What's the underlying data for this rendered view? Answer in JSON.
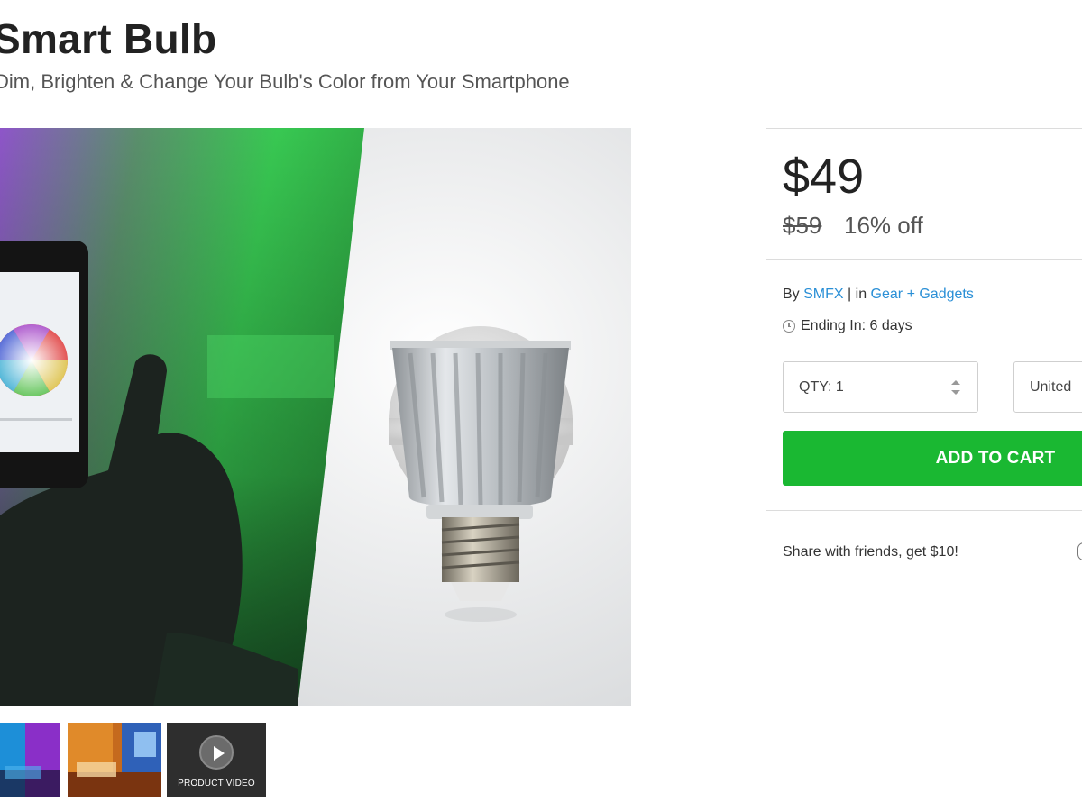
{
  "product": {
    "title": "Smart Bulb",
    "subtitle": "Dim, Brighten & Change Your Bulb's Color from Your Smartphone"
  },
  "gallery": {
    "main_image_icon": "product-photo",
    "thumbnails": [
      {
        "icon": "bedroom-purple-light-photo"
      },
      {
        "icon": "bedroom-orange-light-photo"
      },
      {
        "icon": "play-icon",
        "label": "PRODUCT VIDEO"
      }
    ]
  },
  "pricing": {
    "price": "$49",
    "original_price": "$59",
    "discount": "16% off"
  },
  "meta": {
    "by_prefix": "By",
    "vendor": "SMFX",
    "separator": "|",
    "in_prefix": "in",
    "category": "Gear + Gadgets",
    "ending": "Ending In: 6 days"
  },
  "purchase": {
    "quantity_label": "QTY: 1",
    "country": "United",
    "add_to_cart": "ADD TO CART"
  },
  "share": {
    "text": "Share with friends, get $10!"
  },
  "colors": {
    "accent_green": "#1ab832",
    "link_blue": "#2a8fd6"
  }
}
